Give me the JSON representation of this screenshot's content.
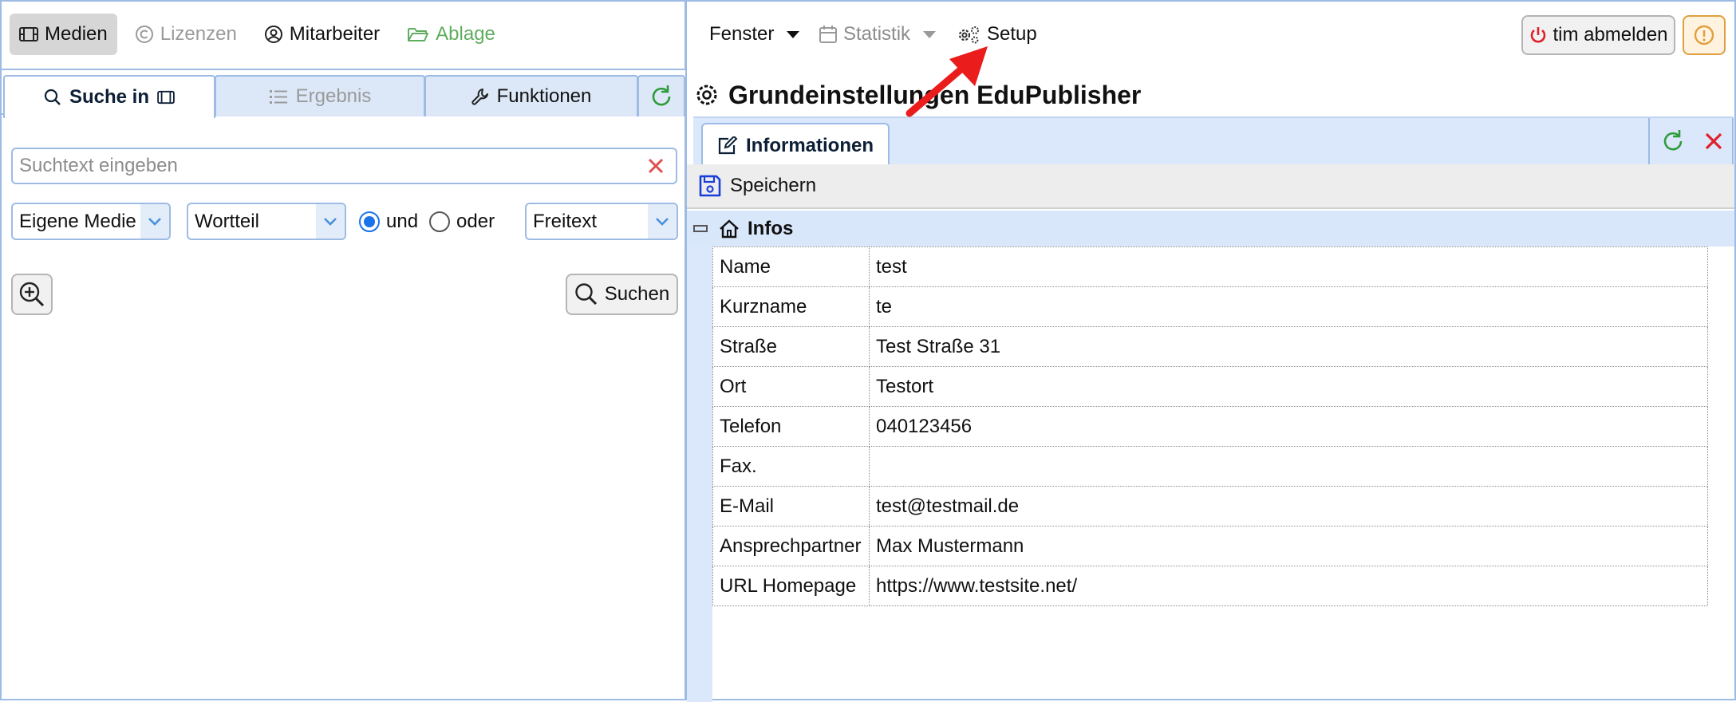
{
  "left_nav": {
    "medien": "Medien",
    "lizenzen": "Lizenzen",
    "mitarbeiter": "Mitarbeiter",
    "ablage": "Ablage"
  },
  "left_tabs": {
    "suche": "Suche in",
    "ergebnis": "Ergebnis",
    "funktionen": "Funktionen"
  },
  "search": {
    "placeholder": "Suchtext eingeben",
    "value": ""
  },
  "filters": {
    "scope": "Eigene Medie",
    "match": "Wortteil",
    "radio_and": "und",
    "radio_or": "oder",
    "field": "Freitext"
  },
  "search_button": "Suchen",
  "right_menu": {
    "fenster": "Fenster",
    "statistik": "Statistik",
    "setup": "Setup",
    "logout": "tim abmelden"
  },
  "page_title": "Grundeinstellungen EduPublisher",
  "right_tab": "Informationen",
  "toolbar": {
    "save": "Speichern"
  },
  "group": "Infos",
  "properties": [
    {
      "key": "Name",
      "value": "test"
    },
    {
      "key": "Kurzname",
      "value": "te"
    },
    {
      "key": "Straße",
      "value": "Test Straße 31"
    },
    {
      "key": "Ort",
      "value": "Testort"
    },
    {
      "key": "Telefon",
      "value": "040123456"
    },
    {
      "key": "Fax.",
      "value": ""
    },
    {
      "key": "E-Mail",
      "value": "test@testmail.de"
    },
    {
      "key": "Ansprechpartner",
      "value": "Max Mustermann"
    },
    {
      "key": "URL Homepage",
      "value": "https://www.testsite.net/"
    }
  ],
  "colors": {
    "accent_blue": "#9dbbe4",
    "tab_bg": "#dbe8fb",
    "green": "#2e9b3a",
    "red": "#e0202a",
    "arrow": "#ea1c1c"
  }
}
